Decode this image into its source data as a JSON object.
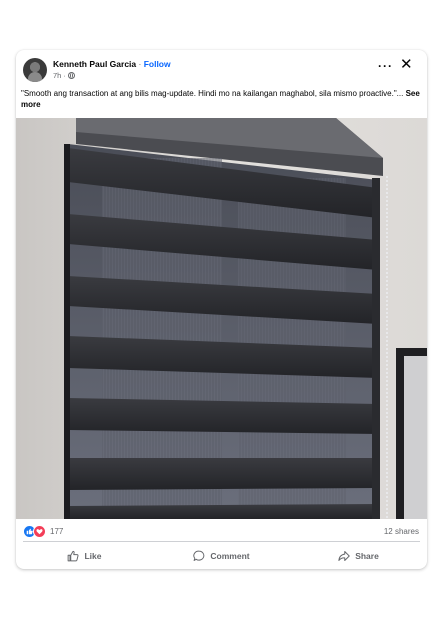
{
  "post": {
    "author": "Kenneth Paul Garcia",
    "separator": " · ",
    "follow_label": "Follow",
    "time": "7h",
    "time_separator": "·",
    "caption": "\"Smooth ang transaction at ang bilis mag-update. Hindi mo na kailangan maghabol, sila mismo proactive.\"...",
    "see_more_label": "See more",
    "more_icon": "more-options-icon",
    "close_icon": "close-icon",
    "privacy_icon": "globe-icon"
  },
  "stats": {
    "reaction_icons": [
      "like-reaction-icon",
      "love-reaction-icon"
    ],
    "reaction_count": "177",
    "shares": "12 shares"
  },
  "actions": {
    "like_label": "Like",
    "comment_label": "Comment",
    "share_label": "Share"
  },
  "colors": {
    "link_blue": "#0866ff",
    "secondary_text": "#65676b",
    "like_blue": "#1877f2",
    "love_red": "#f33e58",
    "blind_dark": "#2b2c30"
  }
}
